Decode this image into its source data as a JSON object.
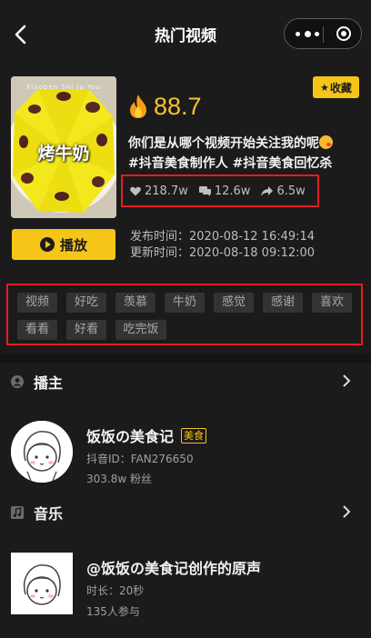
{
  "nav": {
    "title": "热门视频"
  },
  "video": {
    "cover_caption": "烤牛奶",
    "cover_top_text": "Xiaoben Shi Ju You",
    "score": "88.7",
    "collect_label": "收藏",
    "description": "你们是从哪个视频开始关注我的呢",
    "hashtags": "#抖音美食制作人 #抖音美食回忆杀",
    "likes": "218.7w",
    "comments": "12.6w",
    "shares": "6.5w",
    "play_label": "播放",
    "publish_time": "发布时间：2020-08-12 16:49:14",
    "update_time": "更新时间：2020-08-18 09:12:00"
  },
  "tags": [
    "视频",
    "好吃",
    "羡慕",
    "牛奶",
    "感觉",
    "感谢",
    "喜欢",
    "看看",
    "好看",
    "吃完饭"
  ],
  "creator": {
    "section_label": "播主",
    "name": "饭饭の美食记",
    "badge": "美食",
    "id": "抖音ID：FAN276650",
    "fans": "303.8w 粉丝"
  },
  "music": {
    "section_label": "音乐",
    "name": "@饭饭の美食记创作的原声",
    "duration": "时长：20秒",
    "participants": "135人参与"
  },
  "colors": {
    "accent": "#f5c518",
    "score": "#f7c32e",
    "highlight_box": "#e51c23",
    "background": "#1b1b1b"
  }
}
